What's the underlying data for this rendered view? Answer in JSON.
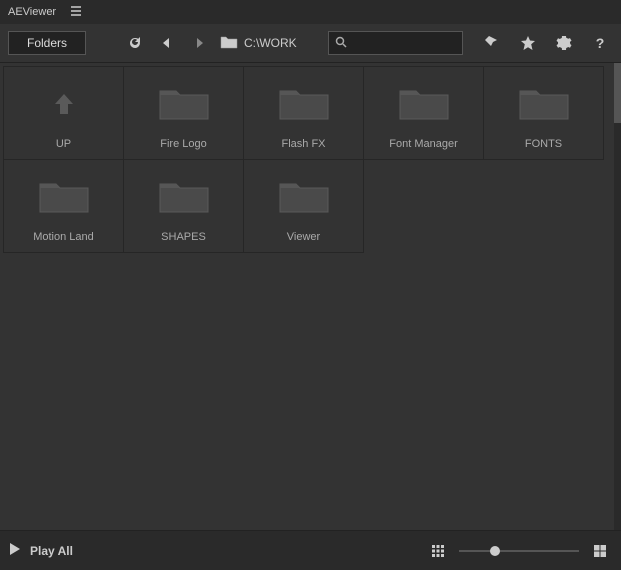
{
  "titlebar": {
    "title": "AEViewer"
  },
  "toolbar": {
    "folders_label": "Folders",
    "path": "C:\\WORK",
    "search_placeholder": ""
  },
  "items": {
    "up": {
      "label": "UP",
      "kind": "up"
    },
    "fire_logo": {
      "label": "Fire Logo",
      "kind": "folder"
    },
    "flash_fx": {
      "label": "Flash FX",
      "kind": "folder"
    },
    "font_manager": {
      "label": "Font Manager",
      "kind": "folder"
    },
    "fonts": {
      "label": "FONTS",
      "kind": "folder"
    },
    "motion_land": {
      "label": "Motion Land",
      "kind": "folder"
    },
    "shapes": {
      "label": "SHAPES",
      "kind": "folder"
    },
    "viewer": {
      "label": "Viewer",
      "kind": "folder"
    }
  },
  "footer": {
    "play_all": "Play All",
    "zoom_pct": 30
  }
}
